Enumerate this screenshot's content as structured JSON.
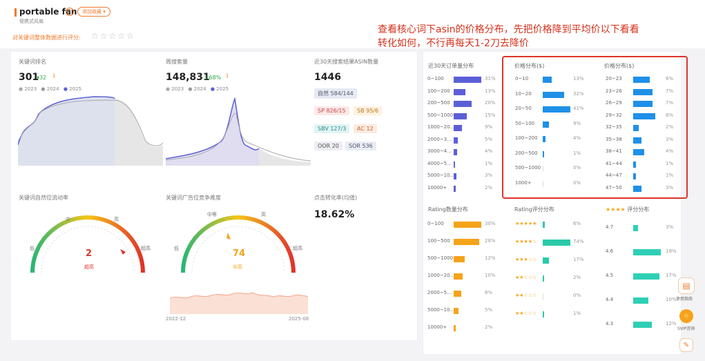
{
  "header": {
    "keyword": "portable fan",
    "subtitle": "便携式风扇",
    "add_button": "添加收藏 ▾",
    "rating_prompt": "对关键词整体数据进行评分:",
    "stars": [
      "☆",
      "☆",
      "☆",
      "☆",
      "☆"
    ]
  },
  "annotation": {
    "line1": "查看核心词下asin的价格分布，先把价格降到平均价以下看看",
    "line2": "转化如何，不行再每天1-2刀去降价"
  },
  "kw_rank": {
    "title": "关键词排名",
    "value": "301",
    "delta": "▾32",
    "legend": [
      "2023",
      "2024",
      "2025"
    ]
  },
  "search_volume": {
    "title": "周搜索量",
    "value": "148,831",
    "delta": "-3.68%",
    "legend": [
      "2023",
      "2024",
      "2025"
    ]
  },
  "asin_count": {
    "title": "近30天搜索结果ASIN数量",
    "value": "1446",
    "tags": {
      "natural": "自然 584/144",
      "sp": "SP 826/15",
      "sb": "SB 95/6",
      "sbv": "SBV 127/3",
      "ac": "AC 12",
      "oor": "OOR 20",
      "sor": "SOR 536"
    }
  },
  "natural_rate": {
    "title": "关键词自然位流动率",
    "value": "2",
    "level": "超高",
    "labels": [
      "低",
      "中",
      "高",
      "超高"
    ]
  },
  "ad_competition": {
    "title": "关键词广告位竞争难度",
    "value": "74",
    "level": "中高",
    "labels": [
      "低",
      "中等",
      "高",
      "超高"
    ],
    "x_start": "2022-12",
    "x_end": "2025-08"
  },
  "conversion": {
    "title": "点击转化率(均值)",
    "value": "18.62%"
  },
  "order_dist": {
    "title": "近30天订单量分布",
    "rows": [
      {
        "label": "0~100",
        "pct": "31%",
        "v": 31
      },
      {
        "label": "100~200",
        "pct": "13%",
        "v": 13
      },
      {
        "label": "200~500",
        "pct": "20%",
        "v": 20
      },
      {
        "label": "500~1000",
        "pct": "15%",
        "v": 15
      },
      {
        "label": "1000~20...",
        "pct": "9%",
        "v": 9
      },
      {
        "label": "2000~3...",
        "pct": "5%",
        "v": 5
      },
      {
        "label": "3000~4...",
        "pct": "4%",
        "v": 4
      },
      {
        "label": "4000~5...",
        "pct": "1%",
        "v": 1
      },
      {
        "label": "5000~10...",
        "pct": "3%",
        "v": 3
      },
      {
        "label": "10000+",
        "pct": "2%",
        "v": 2
      }
    ]
  },
  "price_dist_1": {
    "title": "价格分布($)",
    "rows": [
      {
        "label": "0~10",
        "pct": "13%",
        "v": 13
      },
      {
        "label": "10~20",
        "pct": "32%",
        "v": 32
      },
      {
        "label": "20~50",
        "pct": "41%",
        "v": 41
      },
      {
        "label": "50~100",
        "pct": "9%",
        "v": 9
      },
      {
        "label": "100~200",
        "pct": "4%",
        "v": 4
      },
      {
        "label": "200~500",
        "pct": "1%",
        "v": 1
      },
      {
        "label": "500~1000",
        "pct": "0%",
        "v": 0
      },
      {
        "label": "1000+",
        "pct": "0%",
        "v": 0
      }
    ]
  },
  "price_dist_2": {
    "title": "价格分布($)",
    "rows": [
      {
        "label": "20~23",
        "pct": "6%",
        "v": 6
      },
      {
        "label": "23~26",
        "pct": "7%",
        "v": 7
      },
      {
        "label": "26~29",
        "pct": "7%",
        "v": 7
      },
      {
        "label": "29~32",
        "pct": "8%",
        "v": 8
      },
      {
        "label": "32~35",
        "pct": "2%",
        "v": 2
      },
      {
        "label": "35~38",
        "pct": "3%",
        "v": 3
      },
      {
        "label": "38~41",
        "pct": "4%",
        "v": 4
      },
      {
        "label": "41~44",
        "pct": "1%",
        "v": 1
      },
      {
        "label": "44~47",
        "pct": "1%",
        "v": 1
      },
      {
        "label": "47~50",
        "pct": "3%",
        "v": 3
      }
    ]
  },
  "rating_count": {
    "title": "Rating数量分布",
    "rows": [
      {
        "label": "0~100",
        "pct": "30%",
        "v": 30
      },
      {
        "label": "100~500",
        "pct": "28%",
        "v": 28
      },
      {
        "label": "500~1000",
        "pct": "12%",
        "v": 12
      },
      {
        "label": "1000~20...",
        "pct": "10%",
        "v": 10
      },
      {
        "label": "2000~5...",
        "pct": "8%",
        "v": 8
      },
      {
        "label": "5000~10...",
        "pct": "5%",
        "v": 5
      },
      {
        "label": "10000+",
        "pct": "2%",
        "v": 2
      }
    ]
  },
  "rating_score": {
    "title": "Rating评分分布",
    "rows": [
      {
        "label": "★★★★★",
        "pct": "6%",
        "v": 6
      },
      {
        "label": "★★★★☆",
        "pct": "74%",
        "v": 74
      },
      {
        "label": "★★★☆☆",
        "pct": "17%",
        "v": 17
      },
      {
        "label": "★★☆☆☆",
        "pct": "2%",
        "v": 2
      },
      {
        "label": "★★☆☆☆",
        "pct": "0%",
        "v": 0
      },
      {
        "label": "★★☆☆☆",
        "pct": "1%",
        "v": 1
      }
    ]
  },
  "score_dist": {
    "title": "评分分布",
    "rows": [
      {
        "label": "4.7",
        "pct": "3%",
        "v": 3
      },
      {
        "label": "4.6",
        "pct": "18%",
        "v": 18
      },
      {
        "label": "4.5",
        "pct": "17%",
        "v": 17
      },
      {
        "label": "4.4",
        "pct": "10%",
        "v": 10
      },
      {
        "label": "4.3",
        "pct": "12%",
        "v": 12
      }
    ]
  },
  "side": {
    "guide": "使用指南",
    "vip": "SVIP咨询"
  },
  "colors": {
    "order_bar": "#5b5fd8",
    "price_bar": "#1e90e8",
    "rating_bar": "#f5a31a",
    "score_bar": "#2fcfb5",
    "rating_score_bar": "#2bc9a8",
    "annotation": "#d6321c"
  }
}
